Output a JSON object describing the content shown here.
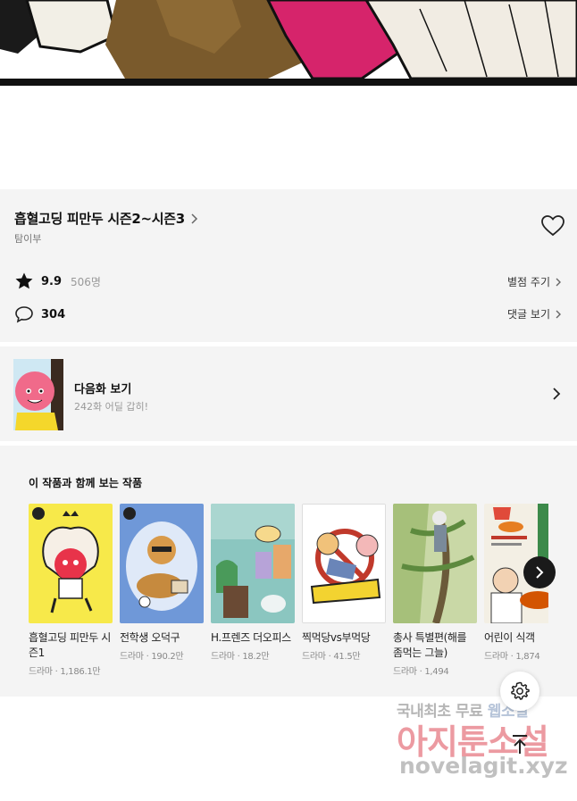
{
  "comic": {
    "alt": ""
  },
  "info": {
    "title": "흡혈고딩 피만두 시즌2~시즌3",
    "author": "탐이부",
    "rating_value": "9.9",
    "rating_count": "506명",
    "rate_link": "별점 주기",
    "comment_count": "304",
    "comment_link": "댓글 보기"
  },
  "next_episode": {
    "title": "다음화 보기",
    "subtitle": "242화 어딜 갑히!"
  },
  "recommend": {
    "heading": "이 작품과 함께 보는 작품",
    "items": [
      {
        "title": "흡혈고딩 피만두 시즌1",
        "meta": "드라마 · 1,186.1만",
        "bg": "#f7e94a"
      },
      {
        "title": "전학생 오덕구",
        "meta": "드라마 · 190.2만",
        "bg": "#6f98d8"
      },
      {
        "title": "H.프렌즈 더오피스",
        "meta": "드라마 · 18.2만",
        "bg": "#8bc6c0"
      },
      {
        "title": "찍먹당vs부먹당",
        "meta": "드라마 · 41.5만",
        "bg": "#ffffff"
      },
      {
        "title": "총사 특별편(해를 좀먹는 그늘)",
        "meta": "드라마 · 1,494",
        "bg": "#c9d8a6"
      },
      {
        "title": "어린이 식객",
        "meta": "드라마 · 1,874",
        "bg": "#f3efe4"
      }
    ]
  },
  "watermark": {
    "line1a": "국내최초 무료",
    "line1b": "웹소설",
    "line2": "아지툰소설",
    "line3": "novelagit.xyz"
  },
  "colors": {
    "panel_bg": "#f4f4f4",
    "accent_pink": "#d6246b"
  }
}
